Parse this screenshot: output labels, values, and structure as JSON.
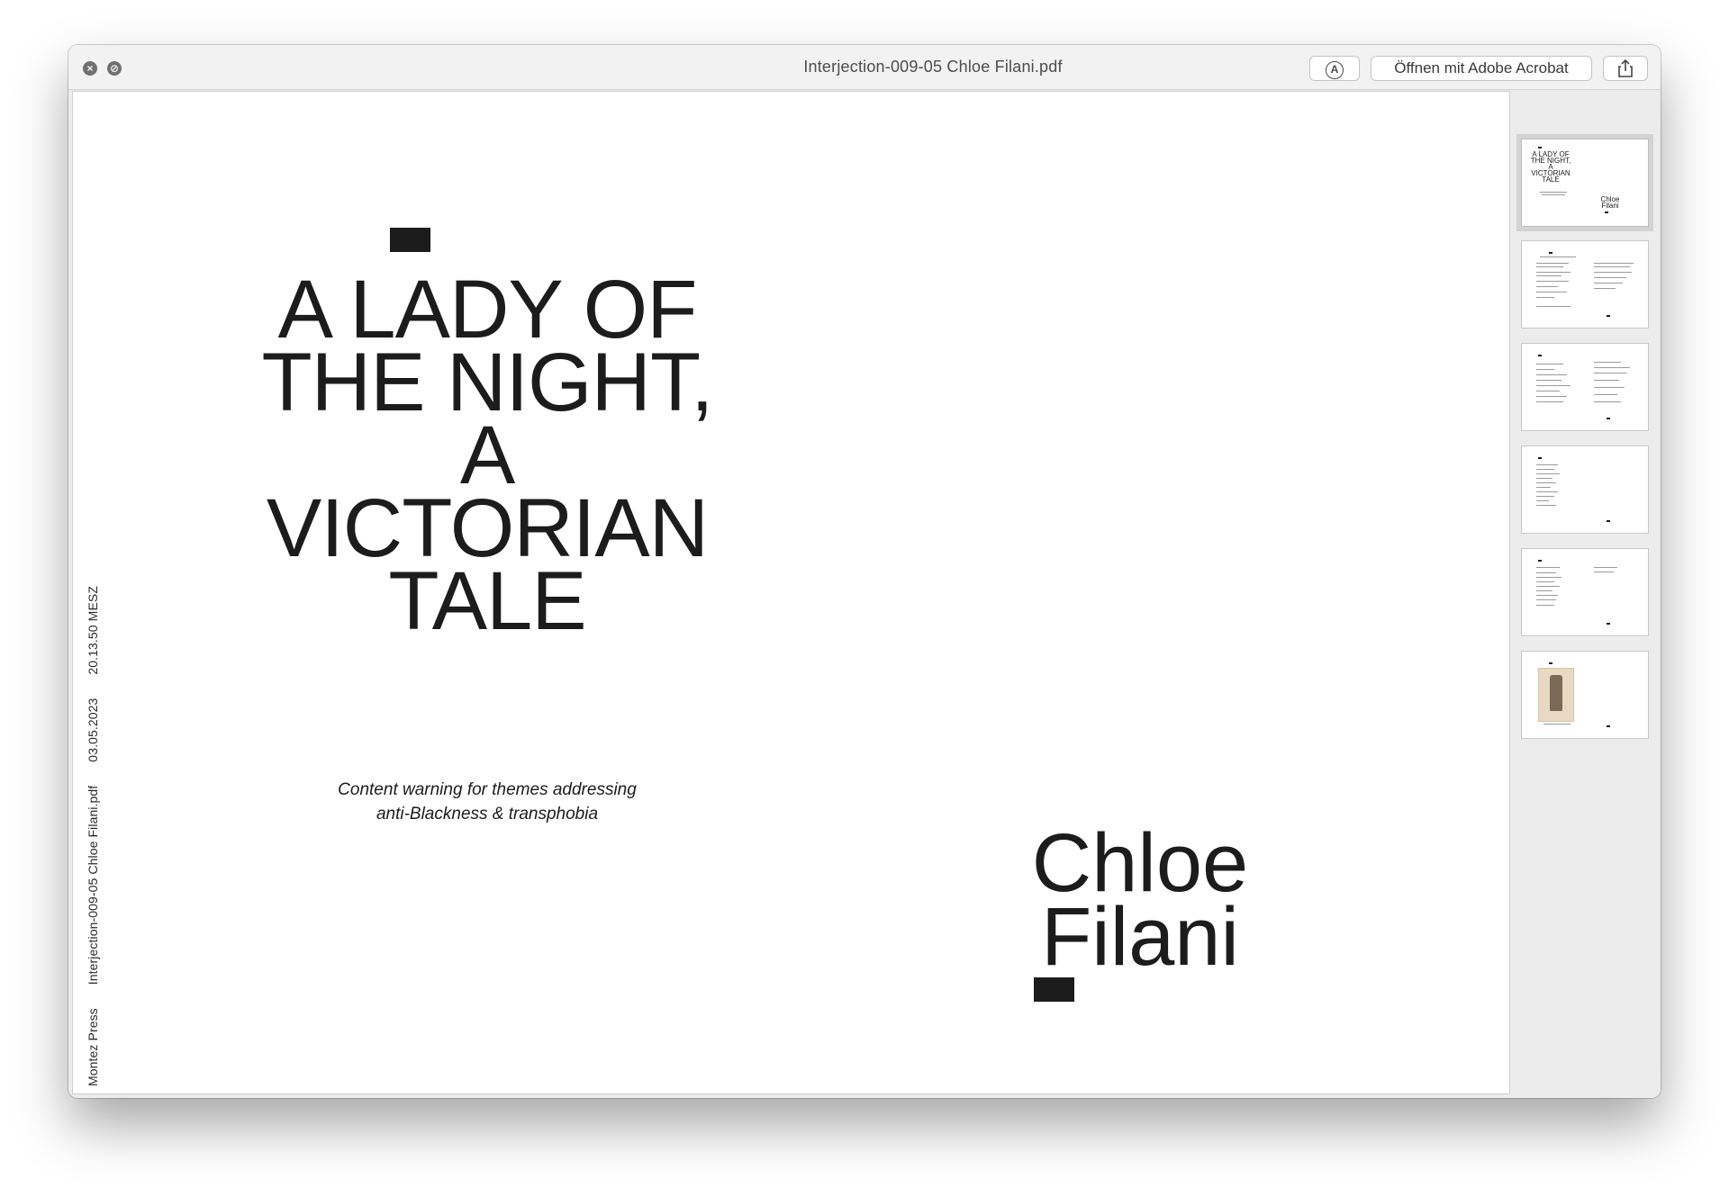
{
  "window": {
    "title": "Interjection-009-05 Chloe Filani.pdf",
    "close_glyph": "×",
    "minimize_glyph": "⊘"
  },
  "toolbar": {
    "markup_glyph": "A",
    "open_with_label": "Öffnen mit Adobe Acrobat",
    "share_glyph": "⇪"
  },
  "page": {
    "title": "A LADY OF\nTHE NIGHT,\nA\nVICTORIAN\nTALE",
    "content_warning": "Content warning for themes addressing\nanti-Blackness & transphobia",
    "author": "Chloe\nFilani",
    "side_publisher": "Montez Press",
    "side_filename": "Interjection-009-05 Chloe Filani.pdf",
    "side_date": "03.05.2023",
    "side_time": "20.13.50 MESZ"
  },
  "sidebar": {
    "thumb1_title": "A LADY OF\nTHE NIGHT,\nA\nVICTORIAN\nTALE",
    "thumb1_author": "Chloe\nFilani"
  },
  "colors": {
    "ink": "#1c1c1c",
    "window_chrome": "#ececec",
    "page": "#ffffff"
  },
  "icons": [
    "close-icon",
    "minimize-icon",
    "markup-icon",
    "share-icon"
  ]
}
